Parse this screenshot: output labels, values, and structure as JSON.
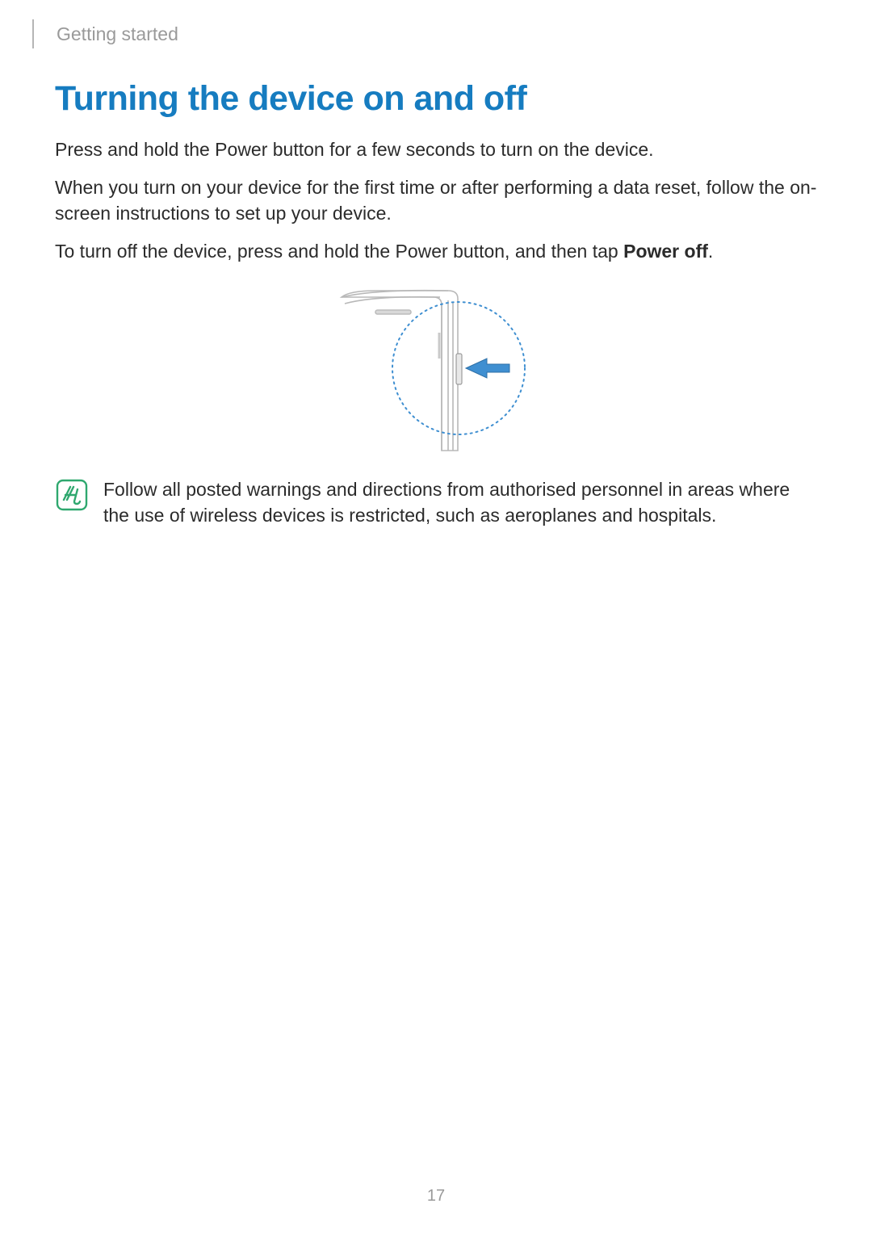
{
  "header": {
    "section": "Getting started"
  },
  "title": "Turning the device on and off",
  "paragraphs": {
    "p1": "Press and hold the Power button for a few seconds to turn on the device.",
    "p2": "When you turn on your device for the first time or after performing a data reset, follow the on-screen instructions to set up your device.",
    "p3_pre": "To turn off the device, press and hold the Power button, and then tap ",
    "p3_bold": "Power off",
    "p3_post": "."
  },
  "note": {
    "text": "Follow all posted warnings and directions from authorised personnel in areas where the use of wireless devices is restricted, such as aeroplanes and hospitals."
  },
  "page_number": "17",
  "colors": {
    "accent": "#167cc0",
    "muted": "#9a9a9a",
    "icon_stroke": "#2fa86f",
    "arrow": "#3f8fd1"
  }
}
